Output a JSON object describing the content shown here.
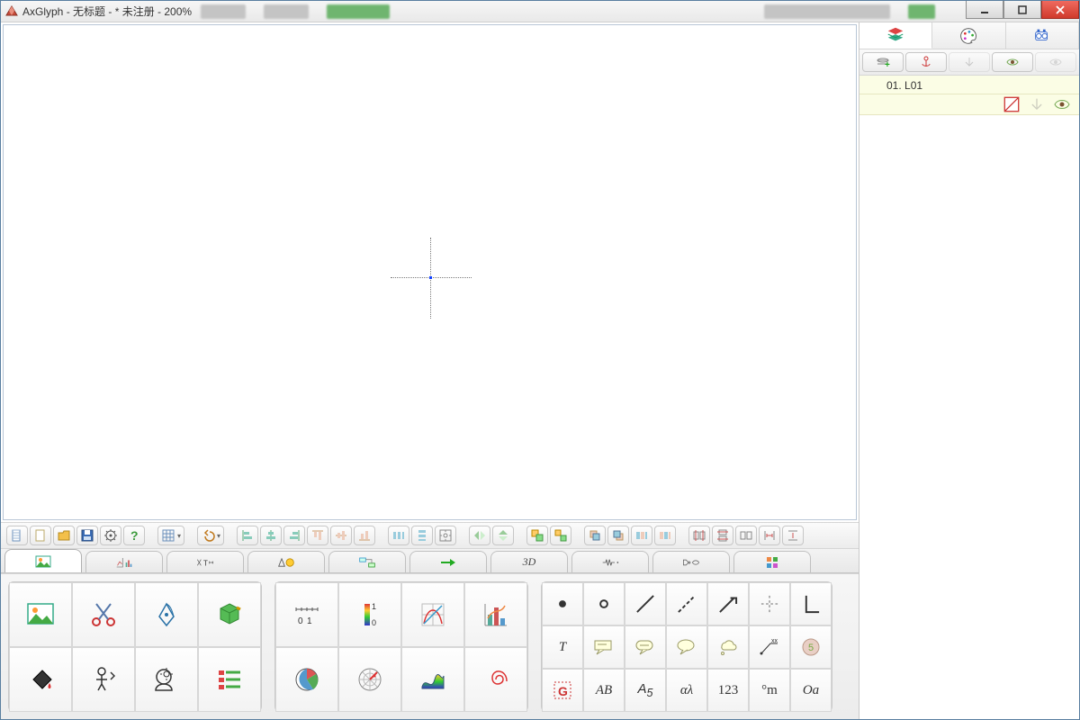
{
  "window": {
    "app_name": "AxGlyph",
    "title_suffix": "无标题 - * 未注册 - 200%"
  },
  "right_panel": {
    "tabs": [
      "layers",
      "styles",
      "animation"
    ],
    "layer_label": "01. L01"
  },
  "tabs": [
    {
      "id": "image",
      "label": ""
    },
    {
      "id": "chart",
      "label": ""
    },
    {
      "id": "text",
      "label": ""
    },
    {
      "id": "shape",
      "label": ""
    },
    {
      "id": "flow",
      "label": ""
    },
    {
      "id": "arrow",
      "label": ""
    },
    {
      "id": "3d",
      "label": "3D"
    },
    {
      "id": "electronics",
      "label": ""
    },
    {
      "id": "logic",
      "label": ""
    },
    {
      "id": "misc",
      "label": ""
    }
  ],
  "palette_group3_labels": {
    "T": "T",
    "AB": "AB",
    "A5": "A",
    "al": "αλ",
    "n123": "123",
    "dm": "°m",
    "Oa": "Oa",
    "5": "5"
  },
  "charttool": {
    "num0": "0",
    "num1": "1",
    "one": "1",
    "zero": "0"
  }
}
